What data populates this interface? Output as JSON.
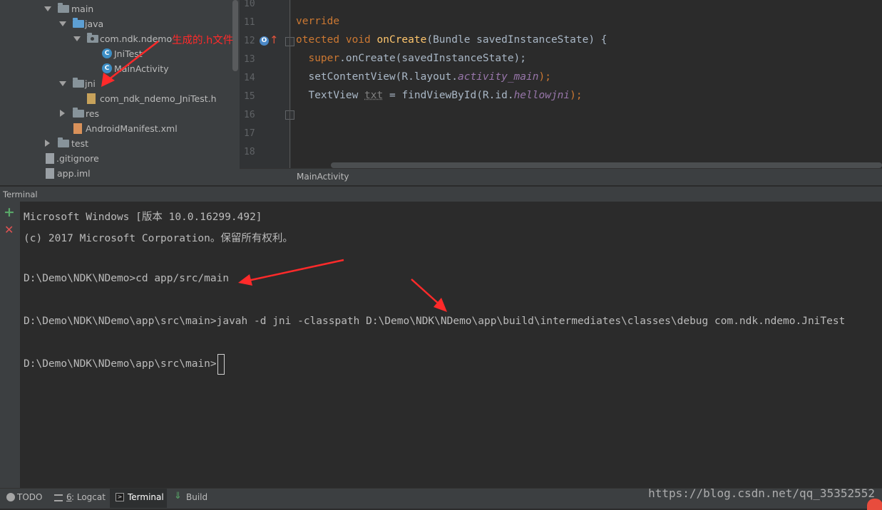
{
  "project_tree": [
    {
      "label": "main",
      "type": "folder"
    },
    {
      "label": "java",
      "type": "folder-blue"
    },
    {
      "label": "com.ndk.ndemo",
      "type": "package"
    },
    {
      "label": "JniTest",
      "type": "class"
    },
    {
      "label": "MainActivity",
      "type": "class"
    },
    {
      "label": "jni",
      "type": "folder"
    },
    {
      "label": "com_ndk_ndemo_JniTest.h",
      "type": "header-file"
    },
    {
      "label": "res",
      "type": "folder"
    },
    {
      "label": "AndroidManifest.xml",
      "type": "xml-file"
    },
    {
      "label": "test",
      "type": "folder"
    },
    {
      "label": ".gitignore",
      "type": "file"
    },
    {
      "label": "app.iml",
      "type": "file"
    }
  ],
  "annotation": {
    "label": "生成的.h文件",
    "color": "#ff2a2a"
  },
  "editor": {
    "line_numbers": [
      "10",
      "11",
      "12",
      "13",
      "14",
      "15",
      "16",
      "17",
      "18"
    ],
    "code": {
      "l11": "verride",
      "l12_kw": "otected void ",
      "l12_fn": "onCreate",
      "l12_rest": "(Bundle savedInstanceState) {",
      "l13_kw": "super",
      "l13_rest": ".onCreate(savedInstanceState);",
      "l14_a": "setContentView(R.layout.",
      "l14_it": "activity_main",
      "l14_b": ");",
      "l15_a": "TextView ",
      "l15_var": "txt",
      "l15_b": " = findViewById(R.id.",
      "l15_it": "hellowjni",
      "l15_c": ");"
    },
    "breadcrumb": "MainActivity"
  },
  "terminal": {
    "title": "Terminal",
    "lines": [
      "Microsoft Windows [版本 10.0.16299.492]",
      "(c) 2017 Microsoft Corporation。保留所有权利。",
      "D:\\Demo\\NDK\\NDemo>cd app/src/main",
      "D:\\Demo\\NDK\\NDemo\\app\\src\\main>javah -d jni -classpath D:\\Demo\\NDK\\NDemo\\app\\build\\intermediates\\classes\\debug com.ndk.ndemo.JniTest",
      "D:\\Demo\\NDK\\NDemo\\app\\src\\main>"
    ]
  },
  "bottom_tabs": {
    "todo": "TODO",
    "logcat_num": "6",
    "logcat": ": Logcat",
    "terminal": "Terminal",
    "build": "Build"
  },
  "watermark": "https://blog.csdn.net/qq_35352552",
  "colors": {
    "keyword": "#cc7832",
    "function": "#ffc66d",
    "field": "#9876aa",
    "annotation": "#ff2a2a"
  }
}
